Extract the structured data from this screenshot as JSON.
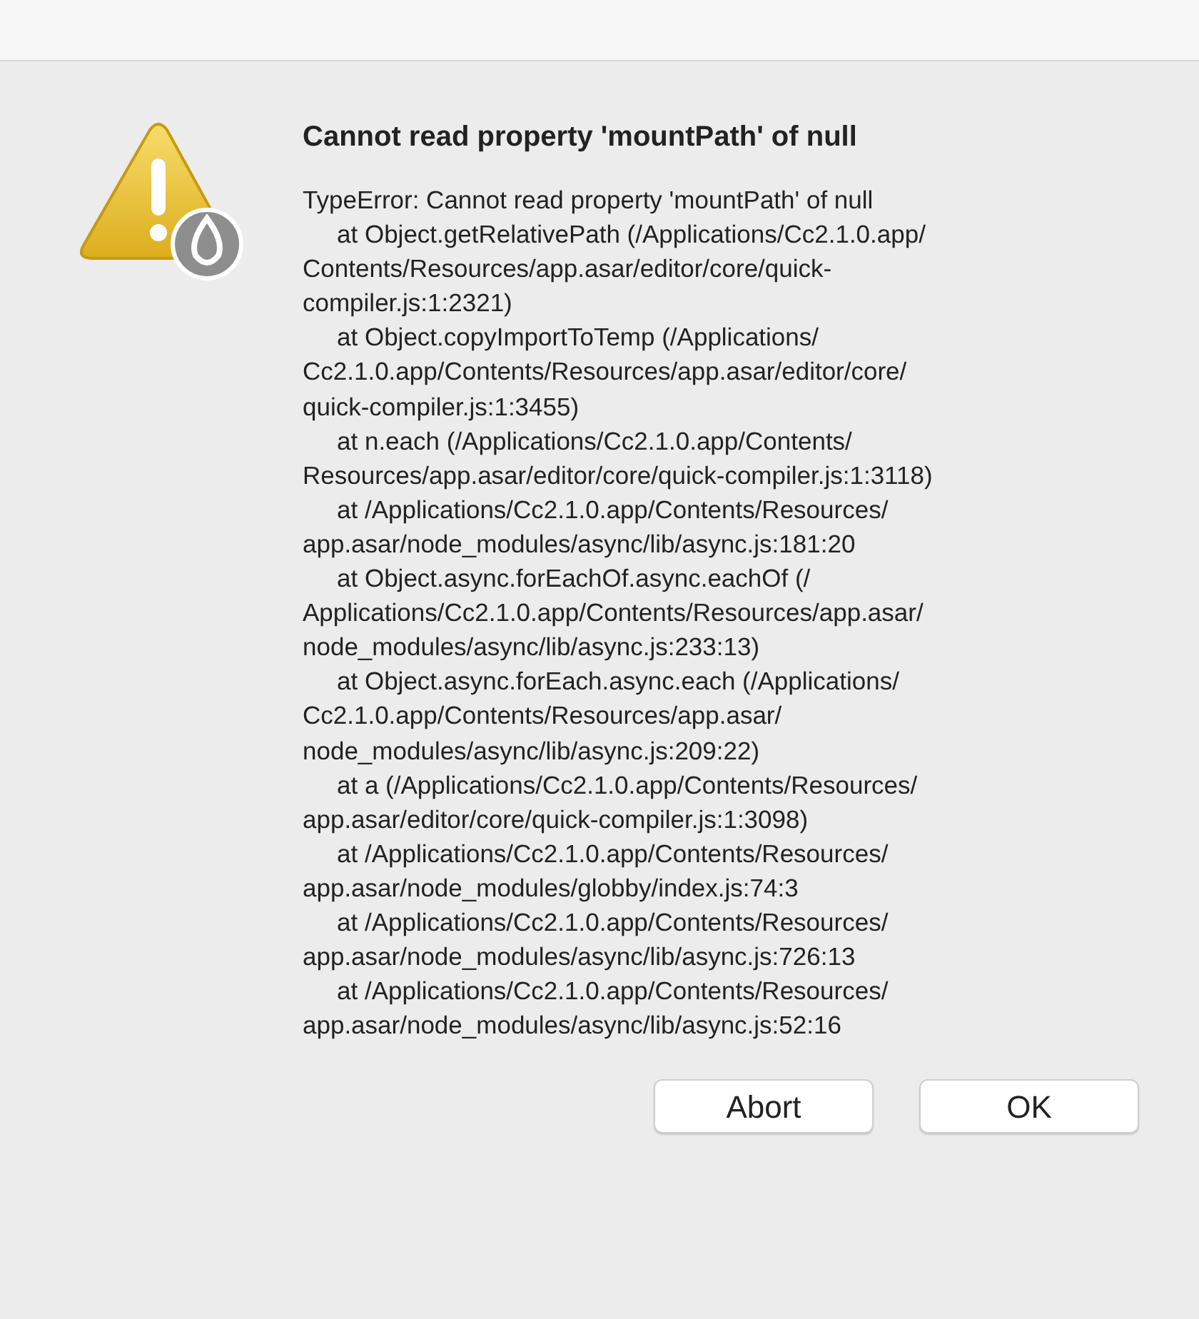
{
  "dialog": {
    "title": "Cannot read property 'mountPath' of null",
    "message_lines": [
      {
        "text": "TypeError: Cannot read property 'mountPath' of null",
        "indent": false
      },
      {
        "text": "at Object.getRelativePath (/Applications/Cc2.1.0.app/",
        "indent": true
      },
      {
        "text": "Contents/Resources/app.asar/editor/core/quick-",
        "indent": false
      },
      {
        "text": "compiler.js:1:2321)",
        "indent": false
      },
      {
        "text": "at Object.copyImportToTemp (/Applications/",
        "indent": true
      },
      {
        "text": "Cc2.1.0.app/Contents/Resources/app.asar/editor/core/",
        "indent": false
      },
      {
        "text": "quick-compiler.js:1:3455)",
        "indent": false
      },
      {
        "text": "at n.each (/Applications/Cc2.1.0.app/Contents/",
        "indent": true
      },
      {
        "text": "Resources/app.asar/editor/core/quick-compiler.js:1:3118)",
        "indent": false
      },
      {
        "text": "at /Applications/Cc2.1.0.app/Contents/Resources/",
        "indent": true
      },
      {
        "text": "app.asar/node_modules/async/lib/async.js:181:20",
        "indent": false
      },
      {
        "text": "at Object.async.forEachOf.async.eachOf (/",
        "indent": true
      },
      {
        "text": "Applications/Cc2.1.0.app/Contents/Resources/app.asar/",
        "indent": false
      },
      {
        "text": "node_modules/async/lib/async.js:233:13)",
        "indent": false
      },
      {
        "text": "at Object.async.forEach.async.each (/Applications/",
        "indent": true
      },
      {
        "text": "Cc2.1.0.app/Contents/Resources/app.asar/",
        "indent": false
      },
      {
        "text": "node_modules/async/lib/async.js:209:22)",
        "indent": false
      },
      {
        "text": "at a (/Applications/Cc2.1.0.app/Contents/Resources/",
        "indent": true
      },
      {
        "text": "app.asar/editor/core/quick-compiler.js:1:3098)",
        "indent": false
      },
      {
        "text": "at /Applications/Cc2.1.0.app/Contents/Resources/",
        "indent": true
      },
      {
        "text": "app.asar/node_modules/globby/index.js:74:3",
        "indent": false
      },
      {
        "text": "at /Applications/Cc2.1.0.app/Contents/Resources/",
        "indent": true
      },
      {
        "text": "app.asar/node_modules/async/lib/async.js:726:13",
        "indent": false
      },
      {
        "text": "at /Applications/Cc2.1.0.app/Contents/Resources/",
        "indent": true
      },
      {
        "text": "app.asar/node_modules/async/lib/async.js:52:16",
        "indent": false
      }
    ],
    "buttons": [
      "Abort",
      "OK"
    ]
  }
}
